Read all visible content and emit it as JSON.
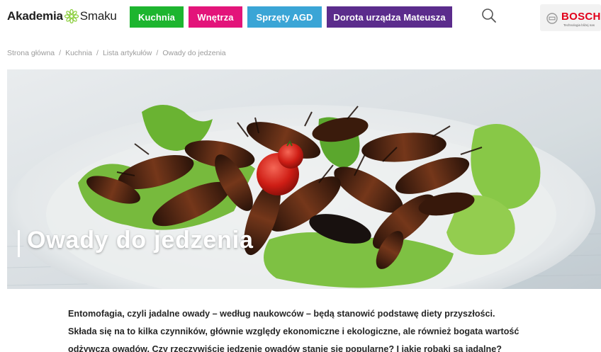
{
  "header": {
    "logo": {
      "word1": "Akademia",
      "word2": "Smaku",
      "icon": "flower-icon",
      "accent": "#8ccf3f"
    },
    "nav": [
      {
        "label": "Kuchnia",
        "color": "#1db52f"
      },
      {
        "label": "Wnętrza",
        "color": "#e3147a"
      },
      {
        "label": "Sprzęty AGD",
        "color": "#3aa5d6"
      },
      {
        "label": "Dorota urządza Mateusza",
        "color": "#5b2c8c"
      }
    ],
    "search_icon": "search-icon",
    "sponsor": {
      "name": "BOSCH",
      "tagline": "Technologia bliżej nas",
      "color": "#e2001a"
    }
  },
  "breadcrumb": [
    "Strona główna",
    "Kuchnia",
    "Lista artykułów",
    "Owady do jedzenia"
  ],
  "hero": {
    "title": "Owady do jedzenia"
  },
  "intro": {
    "lines": [
      "Entomofagia, czyli jadalne owady – według naukowców – będą stanowić podstawę diety przyszłości.",
      "Składa się na to kilka czynników, głównie względy ekonomiczne i ekologiczne, ale również bogata wartość",
      "odżywcza owadów. Czy rzeczywiście jedzenie owadów stanie się popularne? I jakie robaki są jadalne?"
    ]
  }
}
